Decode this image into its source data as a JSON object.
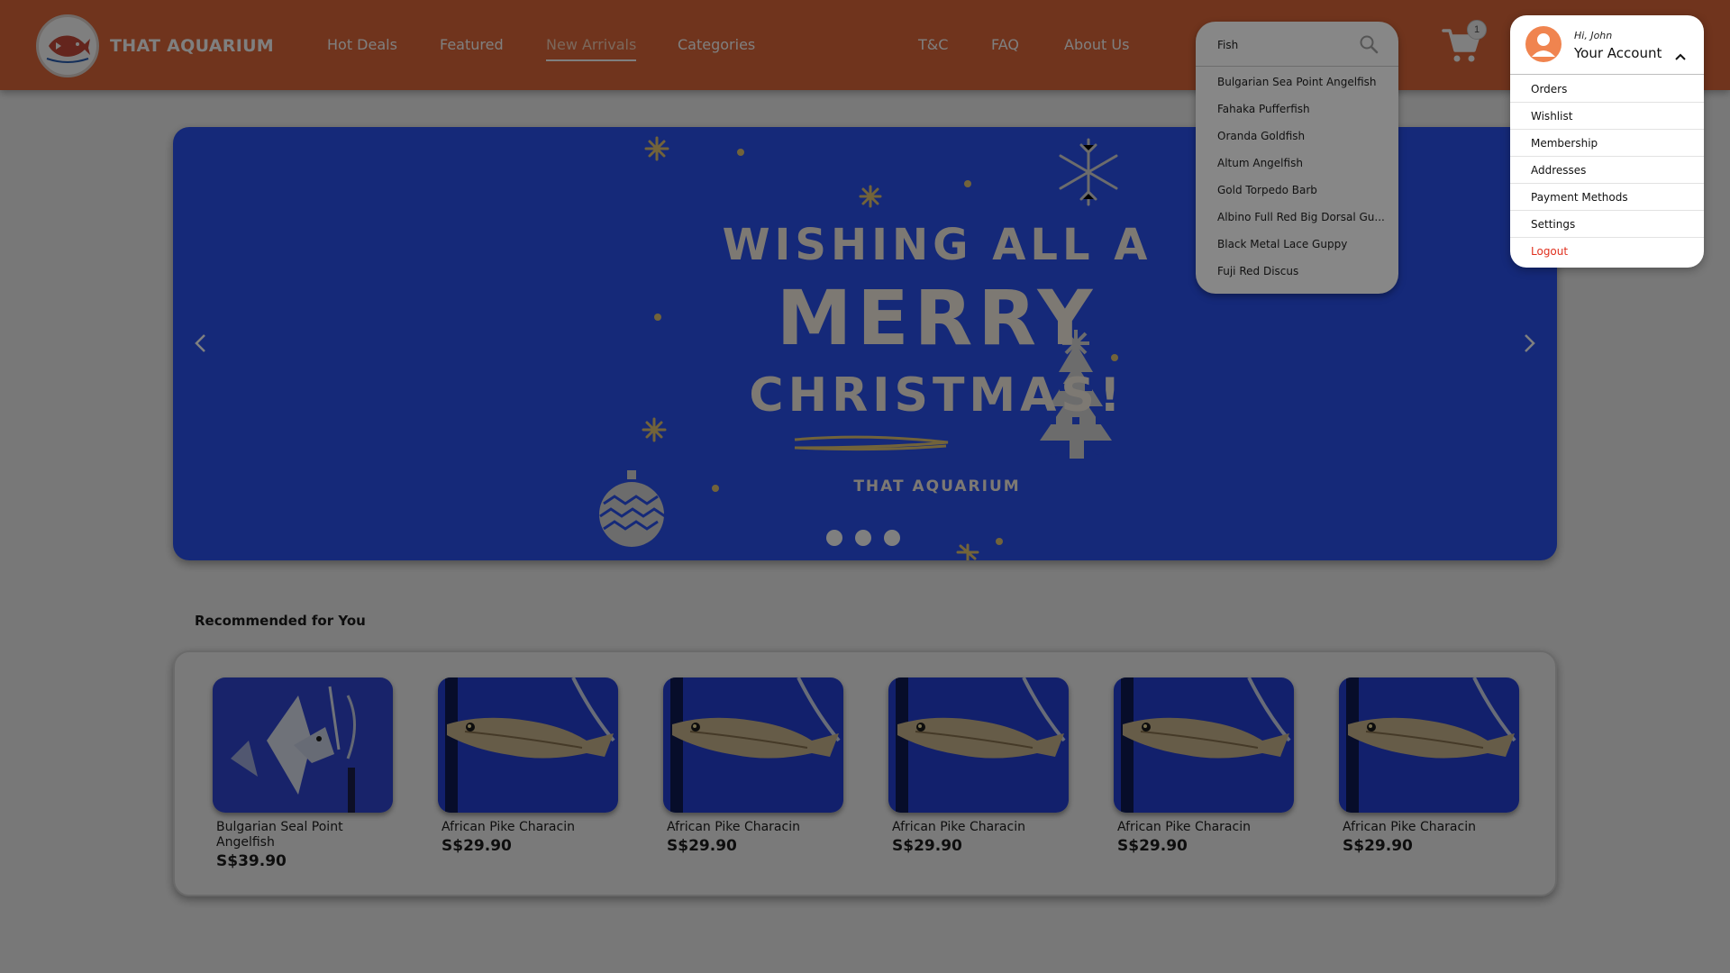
{
  "brand": {
    "name": "THAT AQUARIUM",
    "logo_icon": "fish-logo-icon"
  },
  "nav": {
    "left": [
      "Hot Deals",
      "Featured",
      "New Arrivals",
      "Categories"
    ],
    "right": [
      "T&C",
      "FAQ",
      "About Us"
    ],
    "active": "New Arrivals"
  },
  "cart": {
    "count": "1",
    "icon": "cart-icon"
  },
  "search": {
    "value": "Fish",
    "suggestions": [
      "Bulgarian Sea Point Angelfish",
      "Fahaka Pufferfish",
      "Oranda Goldfish",
      "Altum Angelfish",
      "Gold Torpedo Barb",
      "Albino Full Red Big Dorsal Gu...",
      "Black Metal Lace Guppy",
      "Fuji Red Discus"
    ]
  },
  "account": {
    "greeting": "Hi, John",
    "title": "Your Account",
    "items": [
      "Orders",
      "Wishlist",
      "Membership",
      "Addresses",
      "Payment Methods",
      "Settings"
    ],
    "logout": "Logout"
  },
  "banner": {
    "line1": "WISHING ALL A",
    "line2": "MERRY",
    "line3": "CHRISTMAS!",
    "brand": "THAT AQUARIUM",
    "slides": 3
  },
  "recommended": {
    "title": "Recommended for You",
    "products": [
      {
        "name": "Bulgarian Seal Point Angelfish",
        "price": "S$39.90",
        "image": "angelfish"
      },
      {
        "name": "African Pike Characin",
        "price": "S$29.90",
        "image": "pike"
      },
      {
        "name": "African Pike Characin",
        "price": "S$29.90",
        "image": "pike"
      },
      {
        "name": "African Pike Characin",
        "price": "S$29.90",
        "image": "pike"
      },
      {
        "name": "African Pike Characin",
        "price": "S$29.90",
        "image": "pike"
      },
      {
        "name": "African Pike Characin",
        "price": "S$29.90",
        "image": "pike"
      }
    ]
  },
  "colors": {
    "header": "#e0693a",
    "banner": "#2b52f3",
    "accent": "#f0844f",
    "logout": "#e0301e"
  }
}
